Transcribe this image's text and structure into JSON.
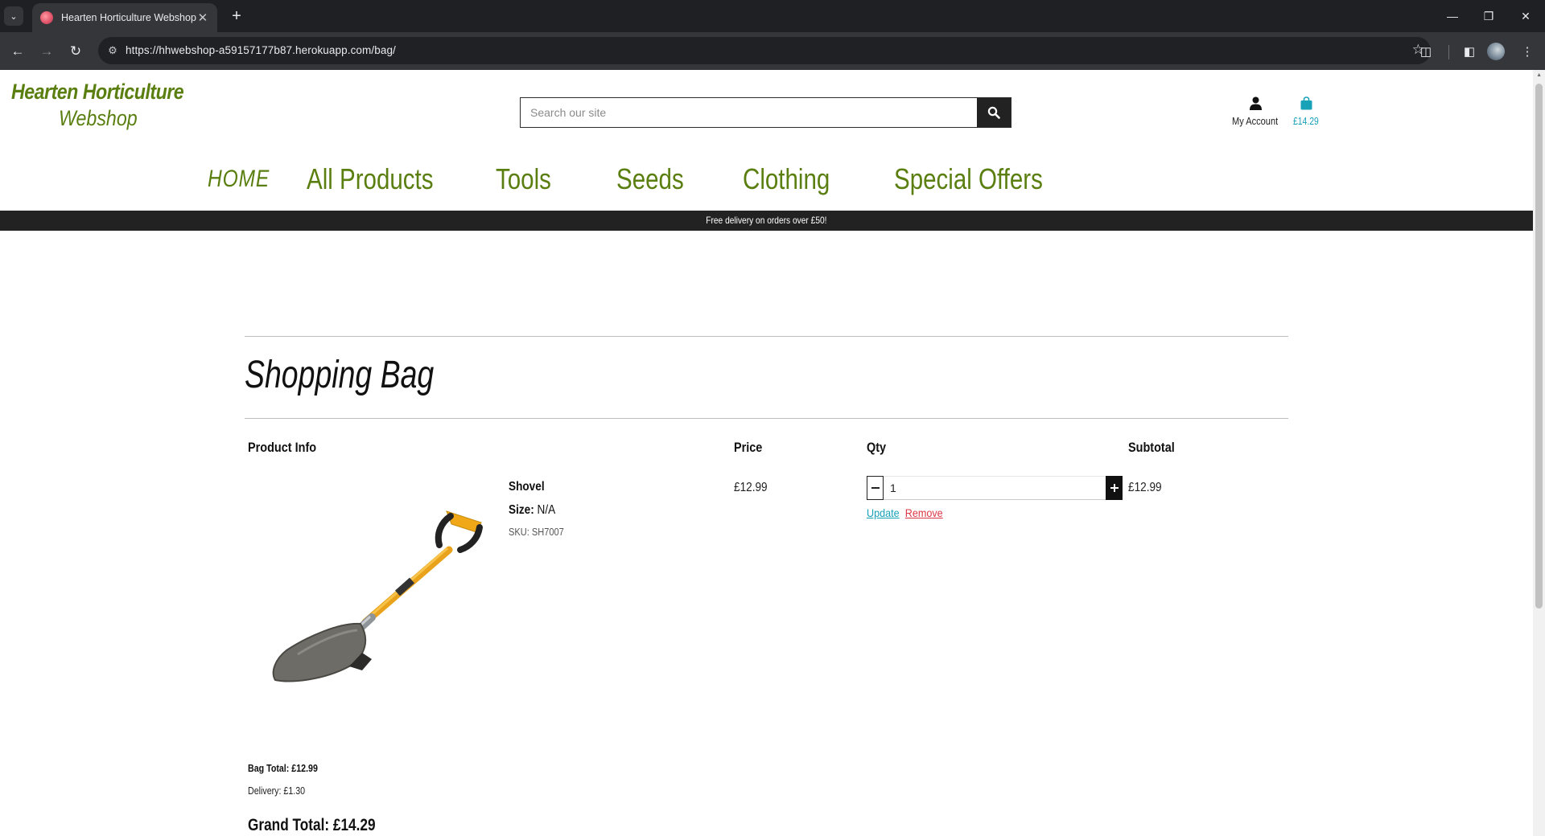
{
  "browser": {
    "tab_title": "Hearten Horticulture Webshop",
    "url": "https://hhwebshop-a59157177b87.herokuapp.com/bag/"
  },
  "site": {
    "logo_line1": "Hearten Horticulture",
    "logo_line2": "Webshop",
    "search_placeholder": "Search our site",
    "account_label": "My Account",
    "bag_amount": "£14.29",
    "brand_color": "#5a7f10",
    "accent_color": "#17a2b8"
  },
  "nav": {
    "home": "HOME",
    "all_products": "All Products",
    "tools": "Tools",
    "seeds": "Seeds",
    "clothing": "Clothing",
    "special_offers": "Special Offers"
  },
  "banner": "Free delivery on orders over £50!",
  "bag": {
    "title": "Shopping Bag",
    "headers": {
      "product_info": "Product Info",
      "price": "Price",
      "qty": "Qty",
      "subtotal": "Subtotal"
    },
    "items": [
      {
        "name": "Shovel",
        "size_label": "Size:",
        "size_value": "N/A",
        "sku": "SKU: SH7007",
        "price": "£12.99",
        "qty": "1",
        "subtotal": "£12.99",
        "update_label": "Update",
        "remove_label": "Remove"
      }
    ],
    "bag_total": "Bag Total: £12.99",
    "delivery": "Delivery: £1.30",
    "grand_total": "Grand Total: £14.29"
  }
}
